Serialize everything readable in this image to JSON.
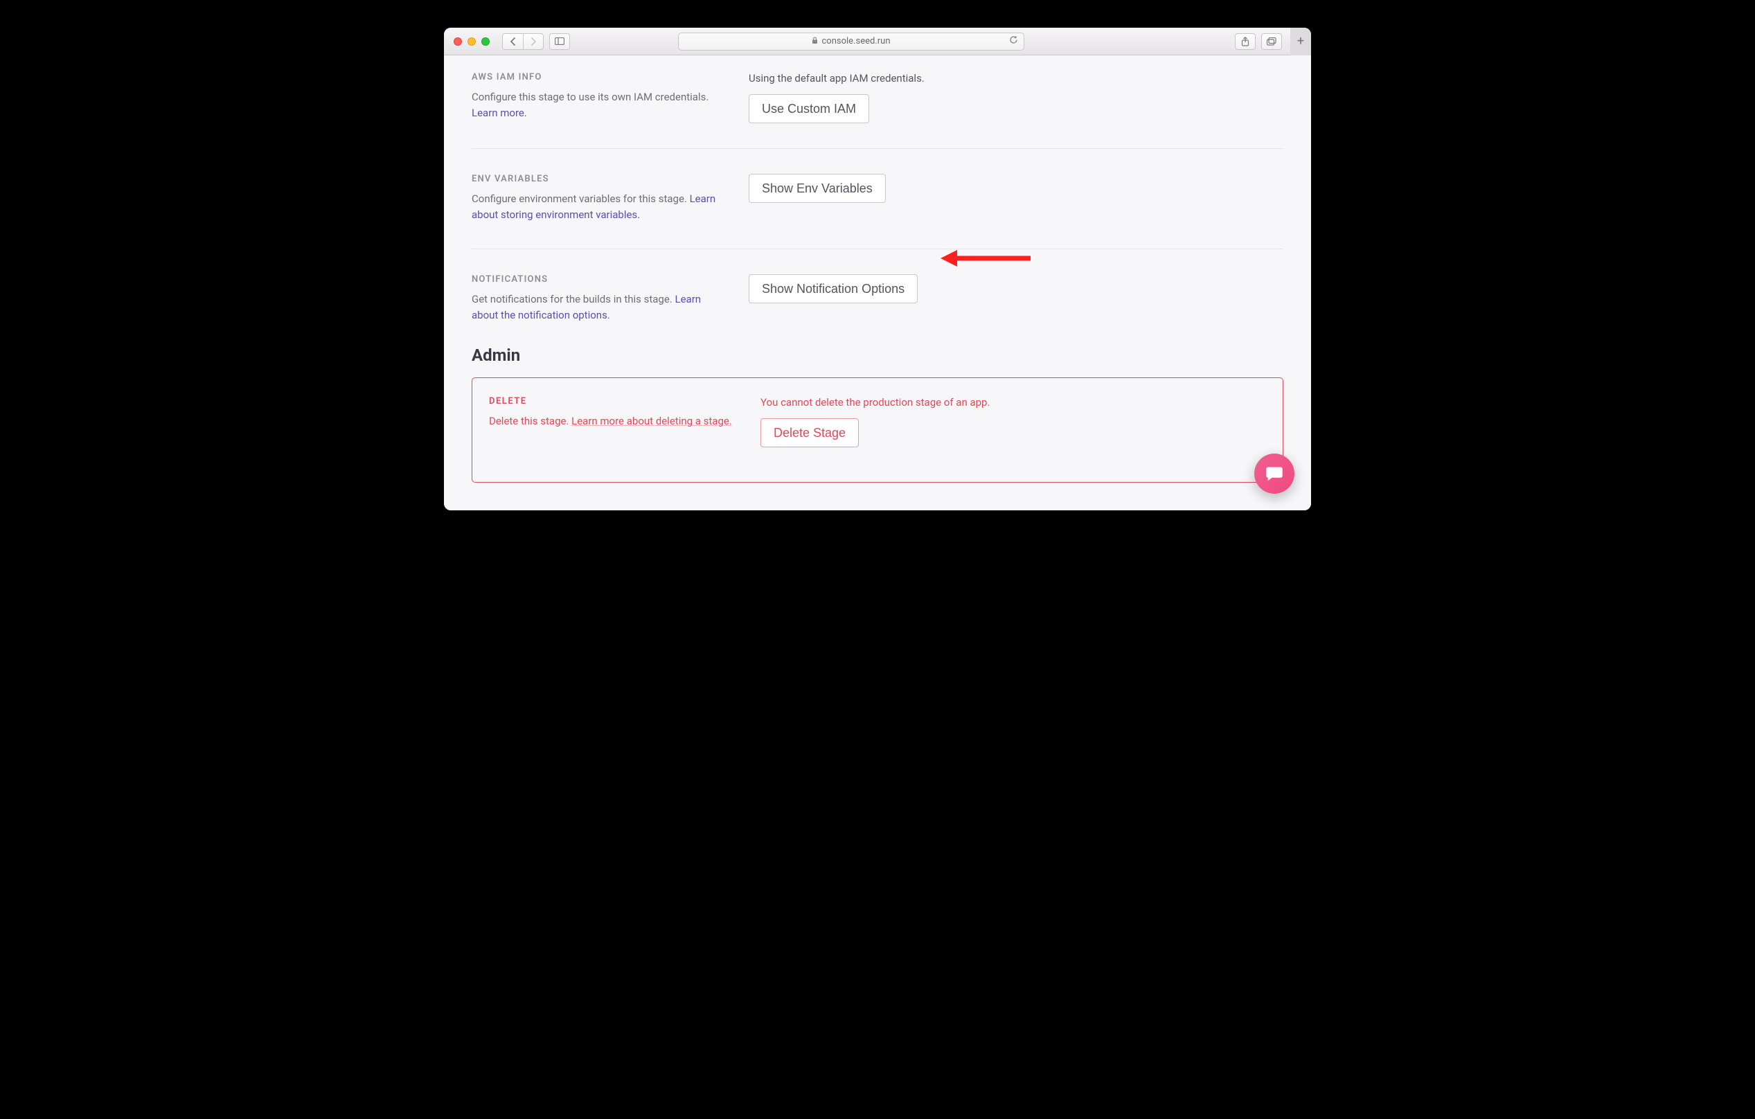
{
  "browser": {
    "url_host": "console.seed.run"
  },
  "sections": {
    "iam": {
      "title": "AWS IAM INFO",
      "desc_prefix": "Configure this stage to use its own IAM credentials. ",
      "desc_link": "Learn more.",
      "status": "Using the default app IAM credentials.",
      "button": "Use Custom IAM"
    },
    "env": {
      "title": "ENV VARIABLES",
      "desc_prefix": "Configure environment variables for this stage. ",
      "desc_link": "Learn about storing environment variables.",
      "button": "Show Env Variables"
    },
    "notif": {
      "title": "NOTIFICATIONS",
      "desc_prefix": "Get notifications for the builds in this stage. ",
      "desc_link": "Learn about the notification options.",
      "button": "Show Notification Options"
    }
  },
  "admin": {
    "heading": "Admin",
    "delete": {
      "title": "DELETE",
      "desc_prefix": "Delete this stage. ",
      "desc_link": "Learn more about deleting a stage.",
      "warning": "You cannot delete the production stage of an app.",
      "button": "Delete Stage"
    }
  }
}
